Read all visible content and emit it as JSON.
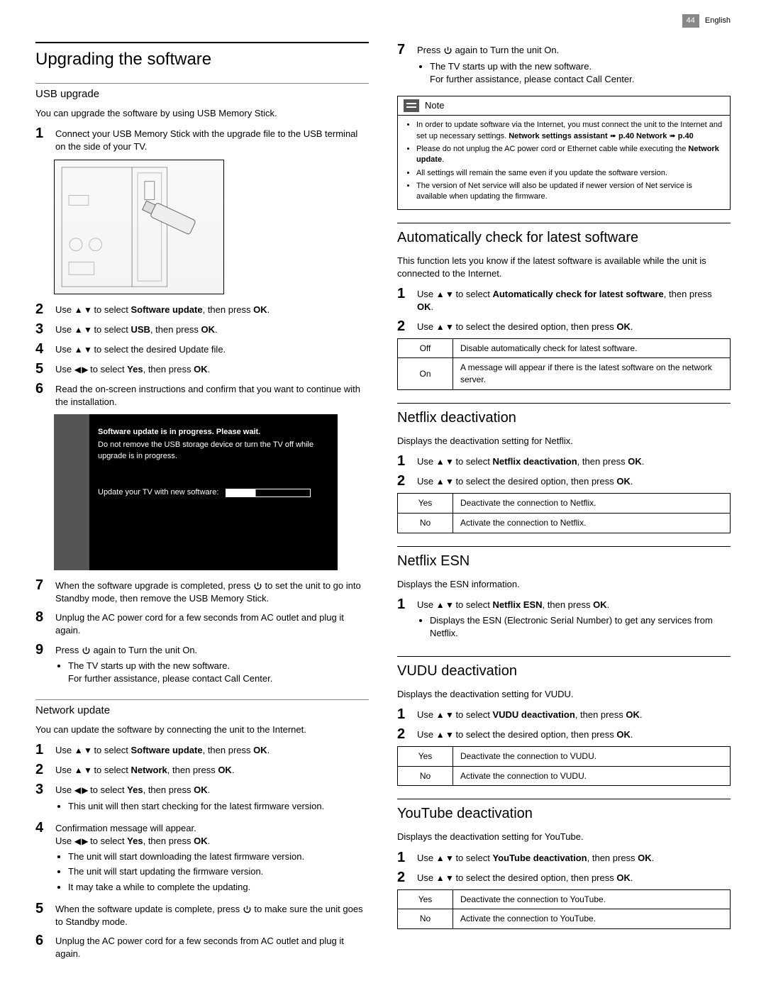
{
  "page": {
    "number": "44",
    "lang": "English"
  },
  "left": {
    "h1": "Upgrading the software",
    "usb": {
      "h3": "USB upgrade",
      "intro": "You can upgrade the software by using USB Memory Stick.",
      "steps": {
        "s1": "Connect your USB Memory Stick with the upgrade file to the USB terminal on the side of your TV.",
        "s2a": "Use ",
        "s2b": " to select ",
        "s2bold": "Software update",
        "s2c": ", then press ",
        "s2ok": "OK",
        "s2d": ".",
        "s3a": "Use ",
        "s3b": " to select ",
        "s3bold": "USB",
        "s3c": ", then press ",
        "s3ok": "OK",
        "s3d": ".",
        "s4a": "Use ",
        "s4b": " to select the desired Update file.",
        "s5a": "Use ",
        "s5b": " to select ",
        "s5bold": "Yes",
        "s5c": ", then press ",
        "s5ok": "OK",
        "s5d": ".",
        "s6": "Read the on-screen instructions and confirm that you want to continue with the installation.",
        "tvmsg1": "Software update is in progress. Please wait.",
        "tvmsg2": "Do not remove the USB storage device or turn the TV off while upgrade is in progress.",
        "tvupd": "Update your TV with new software:",
        "s7a": "When the software upgrade is completed, press ",
        "s7b": " to set the unit to go into Standby mode, then remove the USB Memory Stick.",
        "s8": "Unplug the AC power cord for a few seconds from AC outlet and plug it again.",
        "s9a": "Press ",
        "s9b": " again to Turn the unit On.",
        "s9bul1": "The TV starts up with the new software.",
        "s9bul2": "For further assistance, please contact Call Center."
      }
    },
    "net": {
      "h3": "Network update",
      "intro": "You can update the software by connecting the unit to the Internet.",
      "s1a": "Use ",
      "s1b": " to select ",
      "s1bold": "Software update",
      "s1c": ", then press ",
      "s1ok": "OK",
      "s1d": ".",
      "s2a": "Use ",
      "s2b": " to select ",
      "s2bold": "Network",
      "s2c": ", then press ",
      "s2ok": "OK",
      "s2d": ".",
      "s3a": "Use ",
      "s3b": " to select ",
      "s3bold": "Yes",
      "s3c": ", then press ",
      "s3ok": "OK",
      "s3d": ".",
      "s3bul": "This unit will then start checking for the latest firmware version.",
      "s4a": "Confirmation message will appear.",
      "s4b1": "Use ",
      "s4b2": " to select ",
      "s4bold": "Yes",
      "s4b3": ", then press ",
      "s4ok": "OK",
      "s4b4": ".",
      "s4bul1": "The unit will start downloading the latest firmware version.",
      "s4bul2": "The unit will start updating the firmware version.",
      "s4bul3": "It may take a while to complete the updating.",
      "s5a": "When the software update is complete, press ",
      "s5b": " to make sure the unit goes to Standby mode.",
      "s6": "Unplug the AC power cord for a few seconds from AC outlet and plug it again."
    }
  },
  "right": {
    "top7a": "Press ",
    "top7b": " again to Turn the unit On.",
    "top7bul1": "The TV starts up with the new software.",
    "top7bul2": "For further assistance, please contact Call Center.",
    "note": {
      "label": "Note",
      "n1a": "In order to update software via the Internet, you must connect the unit to the Internet and set up necessary settings. ",
      "n1b": "Network settings assistant ",
      "n1arrow1": "➠",
      "n1p1": " p.40 ",
      "n1c": "Network ",
      "n1arrow2": "➠",
      "n1p2": " p.40",
      "n2a": "Please do not unplug the AC power cord or Ethernet cable while executing the ",
      "n2b": "Network update",
      "n2c": ".",
      "n3": "All settings will remain the same even if you update the software version.",
      "n4": "The version of Net service will also be updated if newer version of Net service is available when updating the firmware."
    },
    "auto": {
      "h2": "Automatically check for latest software",
      "intro": "This function lets you know if the latest software is available while the unit is connected to the Internet.",
      "s1a": "Use ",
      "s1b": " to select ",
      "s1bold": "Automatically check for latest software",
      "s1c": ", then press ",
      "s1ok": "OK",
      "s1d": ".",
      "s2a": "Use ",
      "s2b": " to select the desired option, then press ",
      "s2ok": "OK",
      "s2c": ".",
      "off_l": "Off",
      "off_d": "Disable automatically check for latest software.",
      "on_l": "On",
      "on_d": "A message will appear if there is the latest software on the network server."
    },
    "nfx": {
      "h2": "Netflix deactivation",
      "intro": "Displays the deactivation setting for Netflix.",
      "s1a": "Use ",
      "s1b": " to select ",
      "s1bold": "Netflix deactivation",
      "s1c": ", then press ",
      "s1ok": "OK",
      "s1d": ".",
      "s2a": "Use ",
      "s2b": " to select the desired option, then press ",
      "s2ok": "OK",
      "s2c": ".",
      "yes_l": "Yes",
      "yes_d": "Deactivate the connection to Netflix.",
      "no_l": "No",
      "no_d": "Activate the connection to Netflix."
    },
    "esn": {
      "h2": "Netflix ESN",
      "intro": "Displays the ESN information.",
      "s1a": "Use ",
      "s1b": " to select ",
      "s1bold": "Netflix ESN",
      "s1c": ", then press ",
      "s1ok": "OK",
      "s1d": ".",
      "s1bul": "Displays the ESN (Electronic Serial Number) to get any services from Netflix."
    },
    "vudu": {
      "h2": "VUDU deactivation",
      "intro": "Displays the deactivation setting for VUDU.",
      "s1a": "Use ",
      "s1b": " to select ",
      "s1bold": "VUDU deactivation",
      "s1c": ", then press ",
      "s1ok": "OK",
      "s1d": ".",
      "s2a": "Use ",
      "s2b": " to select the desired option, then press ",
      "s2ok": "OK",
      "s2c": ".",
      "yes_l": "Yes",
      "yes_d": "Deactivate the connection to VUDU.",
      "no_l": "No",
      "no_d": "Activate the connection to VUDU."
    },
    "yt": {
      "h2": "YouTube deactivation",
      "intro": "Displays the deactivation setting for YouTube.",
      "s1a": "Use ",
      "s1b": " to select ",
      "s1bold": "YouTube deactivation",
      "s1c": ", then press ",
      "s1ok": "OK",
      "s1d": ".",
      "s2a": "Use ",
      "s2b": " to select the desired option, then press ",
      "s2ok": "OK",
      "s2c": ".",
      "yes_l": "Yes",
      "yes_d": "Deactivate the connection to YouTube.",
      "no_l": "No",
      "no_d": "Activate the connection to YouTube."
    }
  },
  "glyphs": {
    "updown": "▲ ▼",
    "leftright": "◀ ▶"
  }
}
